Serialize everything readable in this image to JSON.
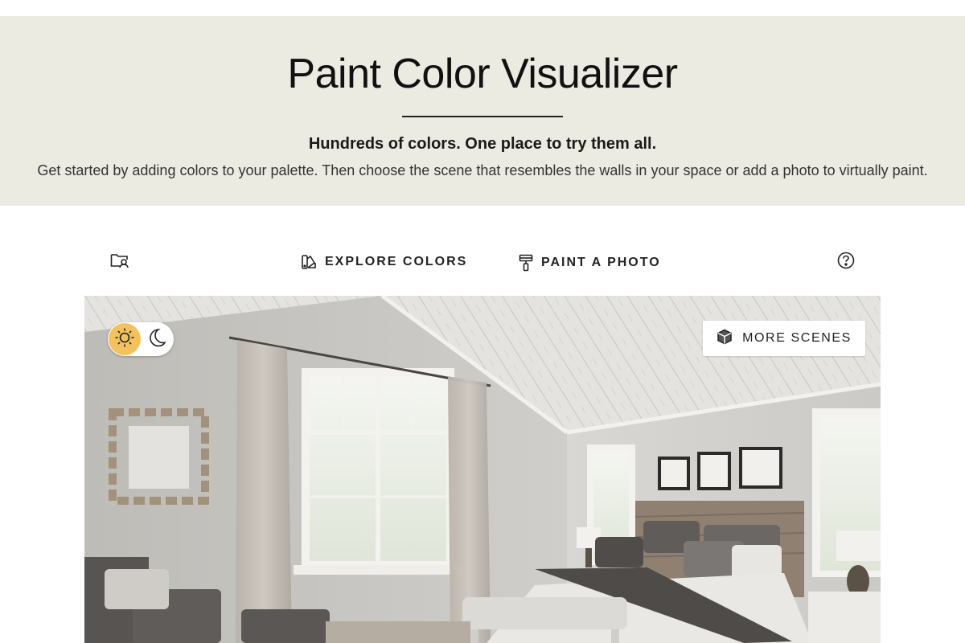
{
  "hero": {
    "title": "Paint Color Visualizer",
    "tagline": "Hundreds of colors. One place to try them all.",
    "intro": "Get started by adding colors to your palette. Then choose the scene that resembles the walls in your space or add a photo to virtually paint."
  },
  "toolbar": {
    "folder_icon": "folder-user-icon",
    "explore_label": "EXPLORE COLORS",
    "explore_icon": "swatch-fan-icon",
    "paint_label": "PAINT A PHOTO",
    "paint_icon": "paint-roller-icon",
    "help_icon": "question-circle-icon"
  },
  "scene": {
    "light_mode_icon": "sun-icon",
    "dark_mode_icon": "moon-icon",
    "active_mode": "light",
    "more_scenes_label": "MORE SCENES",
    "more_scenes_icon": "cube-icon",
    "description": "bedroom"
  },
  "colors": {
    "hero_bg": "#ecebe2",
    "sun_active": "#f3c15e",
    "text": "#222222"
  }
}
